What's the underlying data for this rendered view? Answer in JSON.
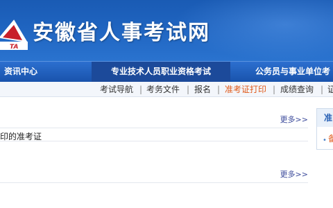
{
  "header": {
    "site_title": "安徽省人事考试网",
    "logo_text": "TA",
    "colors": {
      "banner": "#1f64c0",
      "nav": "#1953ac",
      "accent": "#e05a1b"
    }
  },
  "main_nav": {
    "items": [
      {
        "label": "资讯中心"
      },
      {
        "label": "专业技术人员职业资格考试"
      },
      {
        "label": "公务员与事业单位考"
      }
    ]
  },
  "sub_nav": {
    "items": [
      {
        "label": "考试导航"
      },
      {
        "label": "考务文件"
      },
      {
        "label": "报名"
      },
      {
        "label": "准考证打印"
      },
      {
        "label": "成绩查询"
      },
      {
        "label": "证"
      }
    ],
    "separator": "|"
  },
  "content": {
    "section1": {
      "more_label": "更多>>",
      "item_text": "印的准考证"
    },
    "section2": {
      "more_label": "更多>>"
    }
  },
  "sidebar": {
    "title": "准",
    "item_text": "备"
  }
}
